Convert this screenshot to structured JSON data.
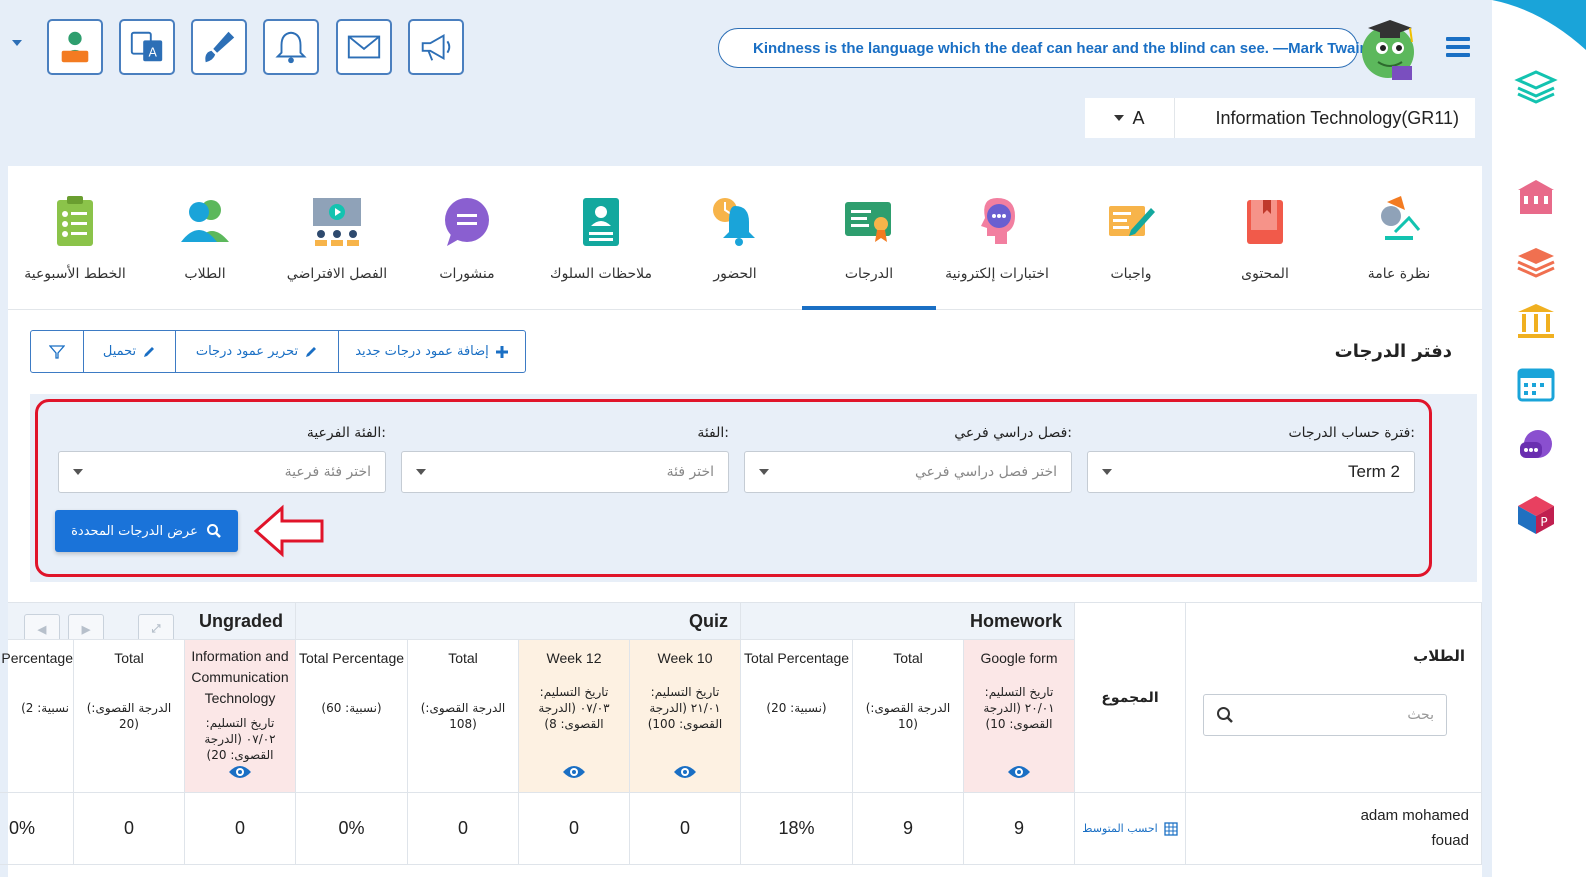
{
  "toolbar": {
    "icons": [
      "teacher-icon",
      "translate-icon",
      "brush-icon",
      "bell-icon",
      "mail-icon",
      "megaphone-icon"
    ]
  },
  "quote": "Kindness is the language which the deaf can hear and the blind can see. —Mark Twain",
  "course": {
    "section": "A",
    "title": "Information Technology(GR11)"
  },
  "tabs": [
    {
      "label": "نظرة عامة",
      "icon": "overview-icon"
    },
    {
      "label": "المحتوى",
      "icon": "content-book-icon"
    },
    {
      "label": "واجبات",
      "icon": "homework-icon"
    },
    {
      "label": "اختبارات إلكترونية",
      "icon": "quiz-icon"
    },
    {
      "label": "الدرجات",
      "icon": "grades-certificate-icon",
      "active": true
    },
    {
      "label": "الحضور",
      "icon": "attendance-icon"
    },
    {
      "label": "ملاحظات السلوك",
      "icon": "behavior-notes-icon"
    },
    {
      "label": "منشورات",
      "icon": "posts-icon"
    },
    {
      "label": "الفصل الافتراضي",
      "icon": "virtual-class-icon"
    },
    {
      "label": "الطلاب",
      "icon": "students-icon"
    },
    {
      "label": "الخطط الأسبوعية",
      "icon": "weekly-plan-icon"
    }
  ],
  "gradebook": {
    "title": "دفتر الدرجات",
    "add_column": "إضافة عمود درجات جديد",
    "edit_column": "تحرير عمود درجات",
    "upload": "تحميل"
  },
  "filters": {
    "period_label": "فترة حساب الدرجات:",
    "period_value": "Term 2",
    "subterm_label": "فصل دراسي فرعي:",
    "subterm_placeholder": "اختر فصل دراسي فرعي",
    "category_label": "الفئة:",
    "category_placeholder": "اختر فئة",
    "subcategory_label": "الفئة الفرعية:",
    "subcategory_placeholder": "اختر فئة فرعية",
    "show_button": "عرض الدرجات المحددة"
  },
  "table": {
    "students_header": "الطلاب",
    "search_placeholder": "بحث",
    "total_header": "المجموع",
    "groups": {
      "homework": "Homework",
      "quiz": "Quiz",
      "ungraded": "Ungraded"
    },
    "columns": {
      "google_form": {
        "title": "Google form",
        "sub": "تاريخ التسليم: ٢٠/٠١ (الدرجة القصوى: 10)"
      },
      "hw_total": {
        "title": "Total",
        "sub": "(الدرجة القصوى: 10)"
      },
      "hw_percentage": {
        "title": "Total Percentage",
        "sub": "(نسبية: 20)"
      },
      "week10": {
        "title": "Week 10",
        "sub": "تاريخ التسليم: ٢١/٠١ (الدرجة القصوى: 100)"
      },
      "week12": {
        "title": "Week 12",
        "sub": "تاريخ التسليم: ٠٧/٠٣ (الدرجة القصوى: 8)"
      },
      "quiz_total": {
        "title": "Total",
        "sub": "(الدرجة القصوى: 108)"
      },
      "quiz_percentage": {
        "title": "Total Percentage",
        "sub": "(نسبية: 60)"
      },
      "ict": {
        "title": "Information and Communication Technology",
        "sub": "تاريخ التسليم: ٠٧/٠٢ (الدرجة القصوى: 20)"
      },
      "ug_total": {
        "title": "Total",
        "sub": "(الدرجة القصوى: 20)"
      },
      "ug_percentage": {
        "title": "Percentage",
        "sub": "(نسبية: 2"
      }
    },
    "rows": [
      {
        "student": "adam mohamed fouad",
        "calc_average": "احسب المتوسط",
        "google_form": "9",
        "hw_total": "9",
        "hw_percentage": "18%",
        "week10": "0",
        "week12": "0",
        "quiz_total": "0",
        "quiz_percentage": "0%",
        "ict": "0",
        "ug_total": "0",
        "ug_percentage": "0%"
      }
    ]
  },
  "sidebar": {
    "icons": [
      "school-icon",
      "books-icon",
      "institution-icon",
      "calendar-icon",
      "chat-icon",
      "app-cube-icon"
    ]
  },
  "colors": {
    "brand": "#1a6fc4",
    "highlight": "#e0142a",
    "homework_col": "#fbe7e7",
    "quiz_col": "#fdf1e2"
  }
}
